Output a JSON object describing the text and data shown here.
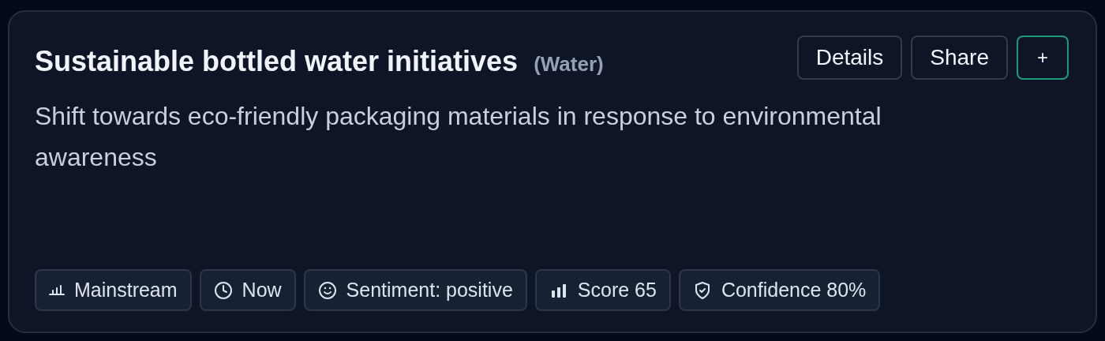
{
  "card": {
    "title": "Sustainable bottled water initiatives",
    "category": "(Water)",
    "actions": [
      {
        "label": "Details",
        "kind": "outline"
      },
      {
        "label": "Share",
        "kind": "outline"
      },
      {
        "label": "+",
        "kind": "accent"
      }
    ],
    "description": "Shift towards eco-friendly packaging materials in response to environmental awareness",
    "chips": [
      {
        "label": "Mainstream",
        "kind": "stage"
      },
      {
        "label": "Now",
        "kind": "time"
      },
      {
        "label": "Sentiment: positive",
        "kind": "sentiment"
      },
      {
        "label": "Score 65",
        "kind": "score"
      },
      {
        "label": "Confidence 80%",
        "kind": "confidence"
      }
    ]
  }
}
